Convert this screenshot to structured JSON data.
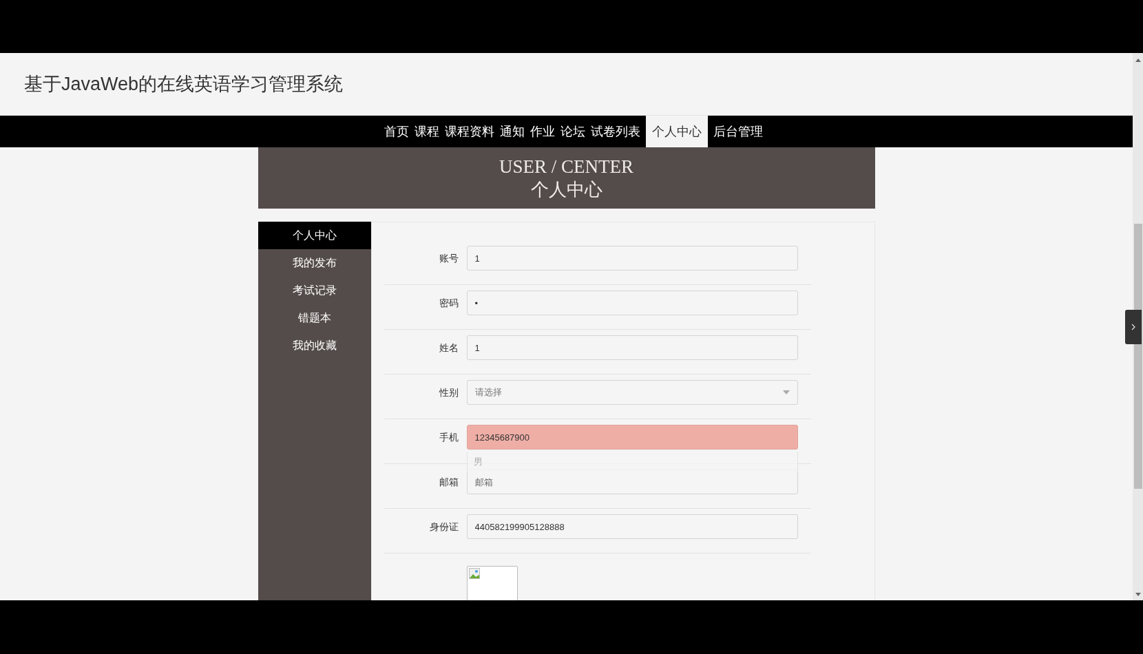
{
  "site_title": "基于JavaWeb的在线英语学习管理系统",
  "nav": [
    {
      "label": "首页",
      "selected": false
    },
    {
      "label": "课程",
      "selected": false
    },
    {
      "label": "课程资料",
      "selected": false
    },
    {
      "label": "通知",
      "selected": false
    },
    {
      "label": "作业",
      "selected": false
    },
    {
      "label": "论坛",
      "selected": false
    },
    {
      "label": "试卷列表",
      "selected": false
    },
    {
      "label": "个人中心",
      "selected": true
    },
    {
      "label": "后台管理",
      "selected": false
    }
  ],
  "banner": {
    "title": "USER / CENTER",
    "subtitle": "个人中心"
  },
  "sidebar": [
    {
      "label": "个人中心",
      "selected": true
    },
    {
      "label": "我的发布",
      "selected": false
    },
    {
      "label": "考试记录",
      "selected": false
    },
    {
      "label": "错题本",
      "selected": false
    },
    {
      "label": "我的收藏",
      "selected": false
    }
  ],
  "form": [
    {
      "label": "账号",
      "kind": "text",
      "value": "1"
    },
    {
      "label": "密码",
      "kind": "text",
      "value": "•"
    },
    {
      "label": "姓名",
      "kind": "text",
      "value": "1"
    },
    {
      "label": "性别",
      "kind": "select",
      "placeholder": "请选择"
    },
    {
      "label": "手机",
      "kind": "highlighted",
      "value": "12345687900"
    },
    {
      "label": "邮箱",
      "kind": "text",
      "placeholder": "邮箱"
    },
    {
      "label": "身份证",
      "kind": "text",
      "value": "440582199905128888"
    }
  ],
  "dropdown": {
    "options": [
      {
        "label": "男",
        "selected": false
      }
    ]
  }
}
